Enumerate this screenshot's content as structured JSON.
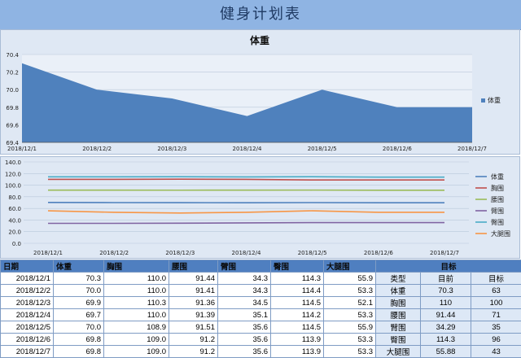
{
  "page_title": "健身计划表",
  "chart_data": [
    {
      "type": "area",
      "title": "体重",
      "categories": [
        "2018/12/1",
        "2018/12/2",
        "2018/12/3",
        "2018/12/4",
        "2018/12/5",
        "2018/12/6",
        "2018/12/7"
      ],
      "series": [
        {
          "name": "体重",
          "values": [
            70.3,
            70.0,
            69.9,
            69.7,
            70.0,
            69.8,
            69.8
          ],
          "color": "#4f81bd"
        }
      ],
      "ylim": [
        69.4,
        70.4
      ],
      "yticks": [
        "69.4",
        "69.6",
        "69.8",
        "70.0",
        "70.2",
        "70.4"
      ],
      "legend": "right",
      "grid": true
    },
    {
      "type": "line",
      "title": "",
      "categories": [
        "2018/12/1",
        "2018/12/2",
        "2018/12/3",
        "2018/12/4",
        "2018/12/5",
        "2018/12/6",
        "2018/12/7"
      ],
      "series": [
        {
          "name": "体重",
          "values": [
            70.3,
            70.0,
            69.9,
            69.7,
            70.0,
            69.8,
            69.8
          ],
          "color": "#4f81bd"
        },
        {
          "name": "胸围",
          "values": [
            110.0,
            110.0,
            110.3,
            110.0,
            108.9,
            109.0,
            109.0
          ],
          "color": "#c0504d"
        },
        {
          "name": "腰围",
          "values": [
            91.44,
            91.41,
            91.36,
            91.39,
            91.51,
            91.2,
            91.2
          ],
          "color": "#9bbb59"
        },
        {
          "name": "臂围",
          "values": [
            34.3,
            34.3,
            34.5,
            35.1,
            35.6,
            35.6,
            35.6
          ],
          "color": "#8064a2"
        },
        {
          "name": "臀围",
          "values": [
            114.3,
            114.4,
            114.5,
            114.2,
            114.5,
            113.9,
            113.9
          ],
          "color": "#4bacc6"
        },
        {
          "name": "大腿围",
          "values": [
            55.9,
            53.3,
            52.1,
            53.3,
            55.9,
            53.3,
            53.3
          ],
          "color": "#f79646"
        }
      ],
      "ylim": [
        0,
        140
      ],
      "yticks": [
        "0.0",
        "20.0",
        "40.0",
        "60.0",
        "80.0",
        "100.0",
        "120.0",
        "140.0"
      ],
      "legend": "right",
      "grid": true
    }
  ],
  "table": {
    "headers": [
      "日期",
      "体重",
      "胸围",
      "腰围",
      "臂围",
      "臀围",
      "大腿围",
      "目标"
    ],
    "rows": [
      {
        "date": "2018/12/1",
        "weight": "70.3",
        "chest": "110.0",
        "waist": "91.44",
        "arm": "34.3",
        "hip": "114.3",
        "thigh": "55.9"
      },
      {
        "date": "2018/12/2",
        "weight": "70.0",
        "chest": "110.0",
        "waist": "91.41",
        "arm": "34.3",
        "hip": "114.4",
        "thigh": "53.3"
      },
      {
        "date": "2018/12/3",
        "weight": "69.9",
        "chest": "110.3",
        "waist": "91.36",
        "arm": "34.5",
        "hip": "114.5",
        "thigh": "52.1"
      },
      {
        "date": "2018/12/4",
        "weight": "69.7",
        "chest": "110.0",
        "waist": "91.39",
        "arm": "35.1",
        "hip": "114.2",
        "thigh": "53.3"
      },
      {
        "date": "2018/12/5",
        "weight": "70.0",
        "chest": "108.9",
        "waist": "91.51",
        "arm": "35.6",
        "hip": "114.5",
        "thigh": "55.9"
      },
      {
        "date": "2018/12/6",
        "weight": "69.8",
        "chest": "109.0",
        "waist": "91.2",
        "arm": "35.6",
        "hip": "113.9",
        "thigh": "53.3"
      },
      {
        "date": "2018/12/7",
        "weight": "69.8",
        "chest": "109.0",
        "waist": "91.2",
        "arm": "35.6",
        "hip": "113.9",
        "thigh": "53.3"
      }
    ],
    "goal_rows": [
      [
        "类型",
        "目前",
        "目标"
      ],
      [
        "体重",
        "70.3",
        "63"
      ],
      [
        "胸围",
        "110",
        "100"
      ],
      [
        "腰围",
        "91.44",
        "71"
      ],
      [
        "臂围",
        "34.29",
        "35"
      ],
      [
        "臀围",
        "114.3",
        "96"
      ],
      [
        "大腿围",
        "55.88",
        "43"
      ]
    ]
  }
}
